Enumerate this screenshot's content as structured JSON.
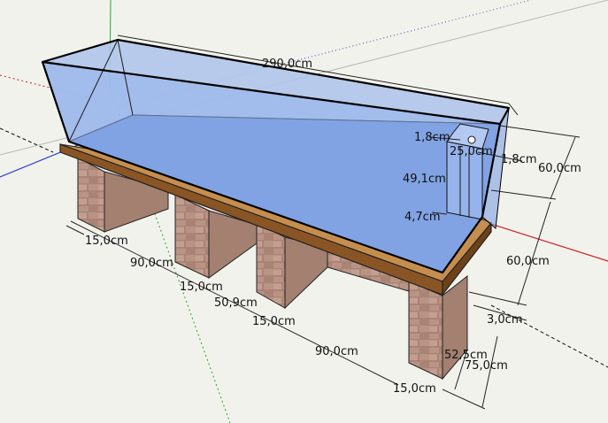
{
  "viewport": {
    "background": "#f2f2ed"
  },
  "colors": {
    "glass_back": "#a9bfe6",
    "glass_side": "#8fb0ee",
    "water_floor": "#6a8fd6",
    "wood_top": "#b07a42",
    "wood_dark": "#7a4a1e",
    "brick": "#b99384",
    "brick_dark": "#8d6a5e",
    "axis_red": "#cc2222",
    "axis_green": "#22aa22",
    "axis_blue": "#2233cc"
  },
  "dimensions": {
    "length_top": "290,0cm",
    "glass_thickness_top": "1,8cm",
    "overflow_width": "25,0cm",
    "glass_thickness_side": "1,8cm",
    "tank_height": "60,0cm",
    "overflow_height": "49,1cm",
    "overflow_gap": "4,7cm",
    "stand_height": "60,0cm",
    "beam_thickness": "3,0cm",
    "stand_depth": "52,5cm",
    "stand_total": "75,0cm",
    "pillar_1": "15,0cm",
    "bay_1": "90,0cm",
    "pillar_2": "15,0cm",
    "bay_mid": "50,9cm",
    "pillar_3": "15,0cm",
    "bay_2": "90,0cm",
    "pillar_4": "15,0cm"
  }
}
